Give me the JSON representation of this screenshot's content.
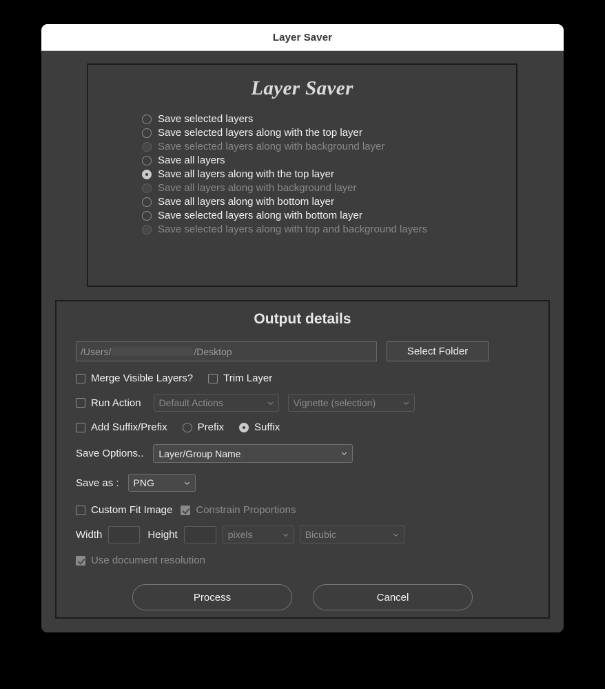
{
  "window": {
    "title": "Layer Saver"
  },
  "modes_panel": {
    "heading": "Layer Saver",
    "options": [
      {
        "label": "Save selected layers",
        "selected": false,
        "disabled": false
      },
      {
        "label": "Save selected layers along with the top layer",
        "selected": false,
        "disabled": false
      },
      {
        "label": "Save selected layers along with background layer",
        "selected": false,
        "disabled": true
      },
      {
        "label": "Save all layers",
        "selected": false,
        "disabled": false
      },
      {
        "label": "Save all layers along with the top layer",
        "selected": true,
        "disabled": false
      },
      {
        "label": "Save all layers along with background layer",
        "selected": false,
        "disabled": true
      },
      {
        "label": "Save all layers along with bottom layer",
        "selected": false,
        "disabled": false
      },
      {
        "label": "Save selected layers along with bottom layer",
        "selected": false,
        "disabled": false
      },
      {
        "label": "Save selected layers along with top and background layers",
        "selected": false,
        "disabled": true
      }
    ]
  },
  "output": {
    "title": "Output details",
    "path": {
      "prefix": "/Users/",
      "suffix": "/Desktop"
    },
    "select_folder_label": "Select Folder",
    "merge_visible": {
      "label": "Merge Visible Layers?",
      "checked": false
    },
    "trim_layer": {
      "label": "Trim Layer",
      "checked": false
    },
    "run_action": {
      "label": "Run Action",
      "checked": false
    },
    "action_set_value": "Default Actions",
    "action_name_value": "Vignette (selection)",
    "add_suffix_prefix": {
      "label": "Add Suffix/Prefix",
      "checked": false
    },
    "prefix_radio": {
      "label": "Prefix",
      "selected": false
    },
    "suffix_radio": {
      "label": "Suffix",
      "selected": true
    },
    "save_options_label": "Save Options..",
    "save_options_value": "Layer/Group Name",
    "save_as_label": "Save as :",
    "save_as_value": "PNG",
    "custom_fit": {
      "label": "Custom Fit Image",
      "checked": false
    },
    "constrain_proportions": {
      "label": "Constrain Proportions",
      "checked": true,
      "disabled": true
    },
    "width_label": "Width",
    "width_value": "",
    "height_label": "Height",
    "height_value": "",
    "units_value": "pixels",
    "resample_value": "Bicubic",
    "use_doc_resolution": {
      "label": "Use document resolution",
      "checked": true,
      "disabled": true
    },
    "process_label": "Process",
    "cancel_label": "Cancel"
  },
  "colors": {
    "window_bg": "#3d3d3d",
    "titlebar_bg": "#ffffff",
    "panel_border": "#1c1c1c",
    "text": "#f2f2f2",
    "text_disabled": "#8c8c8c",
    "accent": "#c9c9c9"
  }
}
